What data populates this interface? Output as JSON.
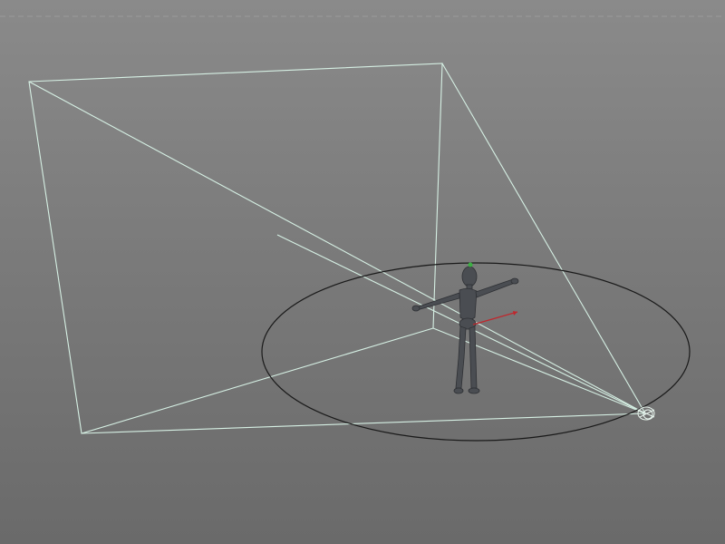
{
  "viewport": {
    "scene": {
      "objects": [
        "camera",
        "camera-frustum",
        "character-figure",
        "ground-circle",
        "direction-arrow"
      ],
      "colors": {
        "background_top": "#8a8a8a",
        "background_bottom": "#6a6a6a",
        "wireframe": "#d6f0e4",
        "figure": "#4a4d52",
        "circle": "#1a1a1a",
        "arrow": "#c0272d",
        "top_joint": "#3cb043"
      }
    }
  }
}
